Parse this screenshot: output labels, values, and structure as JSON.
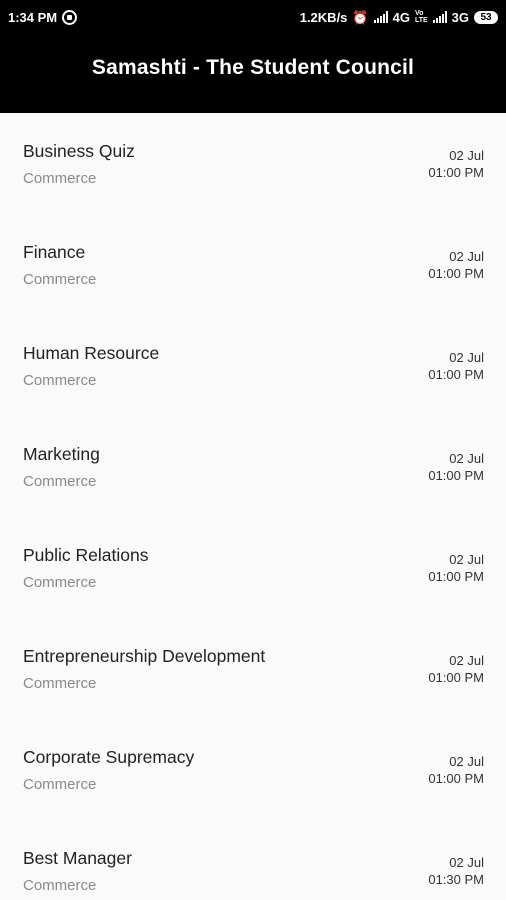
{
  "status_bar": {
    "time": "1:34 PM",
    "speed": "1.2KB/s",
    "net1": "4G",
    "volte_top": "Vo",
    "volte_bottom": "LTE",
    "net2": "3G",
    "battery": "53"
  },
  "app_bar": {
    "title": "Samashti - The Student Council"
  },
  "events": [
    {
      "title": "Business Quiz",
      "category": "Commerce",
      "date": "02 Jul",
      "time": "01:00 PM"
    },
    {
      "title": "Finance",
      "category": "Commerce",
      "date": "02 Jul",
      "time": "01:00 PM"
    },
    {
      "title": "Human Resource",
      "category": "Commerce",
      "date": "02 Jul",
      "time": "01:00 PM"
    },
    {
      "title": "Marketing",
      "category": "Commerce",
      "date": "02 Jul",
      "time": "01:00 PM"
    },
    {
      "title": "Public Relations",
      "category": "Commerce",
      "date": "02 Jul",
      "time": "01:00 PM"
    },
    {
      "title": "Entrepreneurship Development",
      "category": "Commerce",
      "date": "02 Jul",
      "time": "01:00 PM"
    },
    {
      "title": "Corporate Supremacy",
      "category": "Commerce",
      "date": "02 Jul",
      "time": "01:00 PM"
    },
    {
      "title": "Best Manager",
      "category": "Commerce",
      "date": "02 Jul",
      "time": "01:30 PM"
    }
  ]
}
